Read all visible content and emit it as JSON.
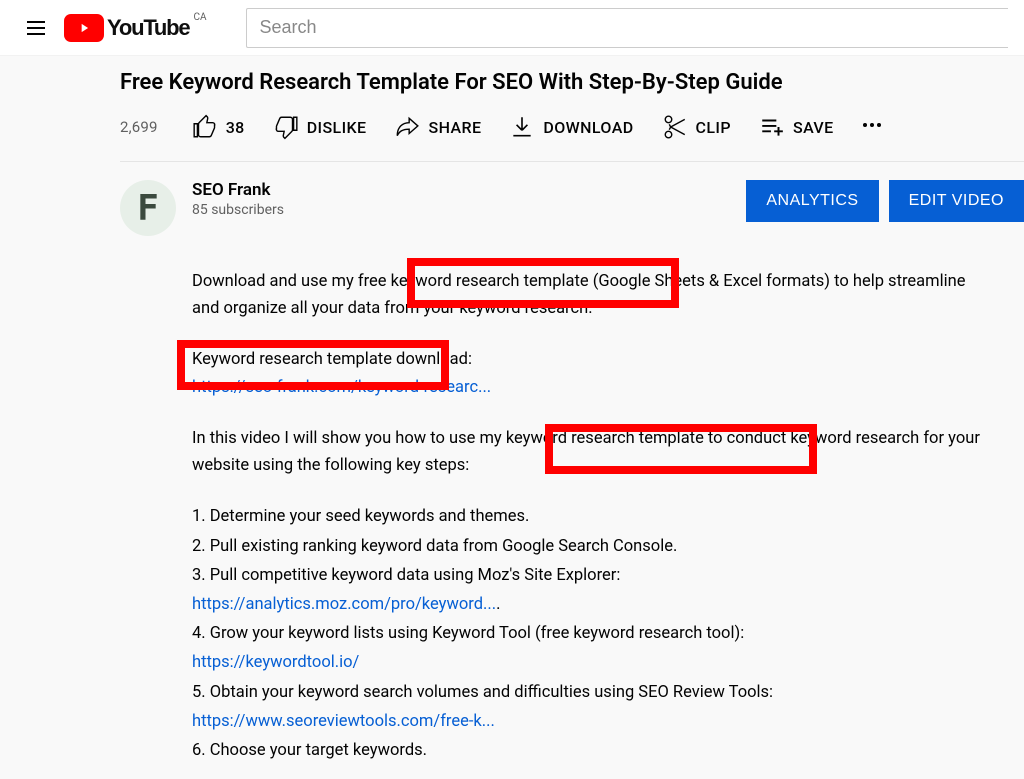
{
  "header": {
    "logo_text": "YouTube",
    "country_code": "CA",
    "search_placeholder": "Search"
  },
  "video": {
    "title": "Free Keyword Research Template For SEO With Step-By-Step Guide",
    "views": "2,699"
  },
  "actions": {
    "like_count": "38",
    "dislike_label": "DISLIKE",
    "share_label": "SHARE",
    "download_label": "DOWNLOAD",
    "clip_label": "CLIP",
    "save_label": "SAVE"
  },
  "channel": {
    "name": "SEO Frank",
    "subs": "85 subscribers",
    "analytics_label": "ANALYTICS",
    "edit_label": "EDIT VIDEO",
    "avatar_letter": "F"
  },
  "description": {
    "para1": "Download and use my free keyword research template (Google Sheets & Excel formats) to help streamline and organize all your data from your keyword research.",
    "para2_label": "Keyword research template download:",
    "para2_link": "https://seo-frank.com/keyword-researc...",
    "para3": "In this video I will show you how to use my keyword research template to conduct keyword research for your website using the following key steps:",
    "steps": {
      "s1": "1. Determine your seed keywords and themes.",
      "s2": "2. Pull existing ranking keyword data from Google Search Console.",
      "s3a": "3. Pull competitive keyword data using Moz's Site Explorer:",
      "s3link": "https://analytics.moz.com/pro/keyword...",
      "s3dot": ".",
      "s4": "4. Grow your keyword lists using Keyword Tool (free keyword research tool):",
      "s4link": "https://keywordtool.io/",
      "s5": "5. Obtain your keyword search volumes and difficulties using SEO Review Tools:",
      "s5link": "https://www.seoreviewtools.com/free-k...",
      "s6": "6. Choose your target keywords."
    }
  }
}
